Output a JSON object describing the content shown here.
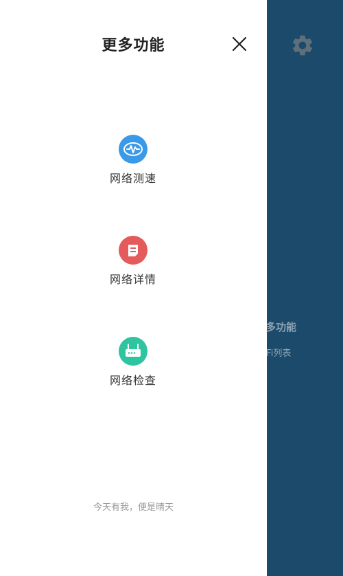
{
  "background": {
    "color": "#1b4a6b",
    "icon": "gear-icon",
    "partial_label_1": "更多功能",
    "partial_label_2": "WiFi列表"
  },
  "drawer": {
    "title": "更多功能",
    "close_icon": "close-icon",
    "items": [
      {
        "label": "网络测速",
        "icon": "speed-test-icon",
        "color": "#3b9ae8"
      },
      {
        "label": "网络详情",
        "icon": "details-icon",
        "color": "#e55a5a"
      },
      {
        "label": "网络检查",
        "icon": "router-icon",
        "color": "#2ec4a0"
      }
    ],
    "footer": "今天有我，便是晴天"
  }
}
